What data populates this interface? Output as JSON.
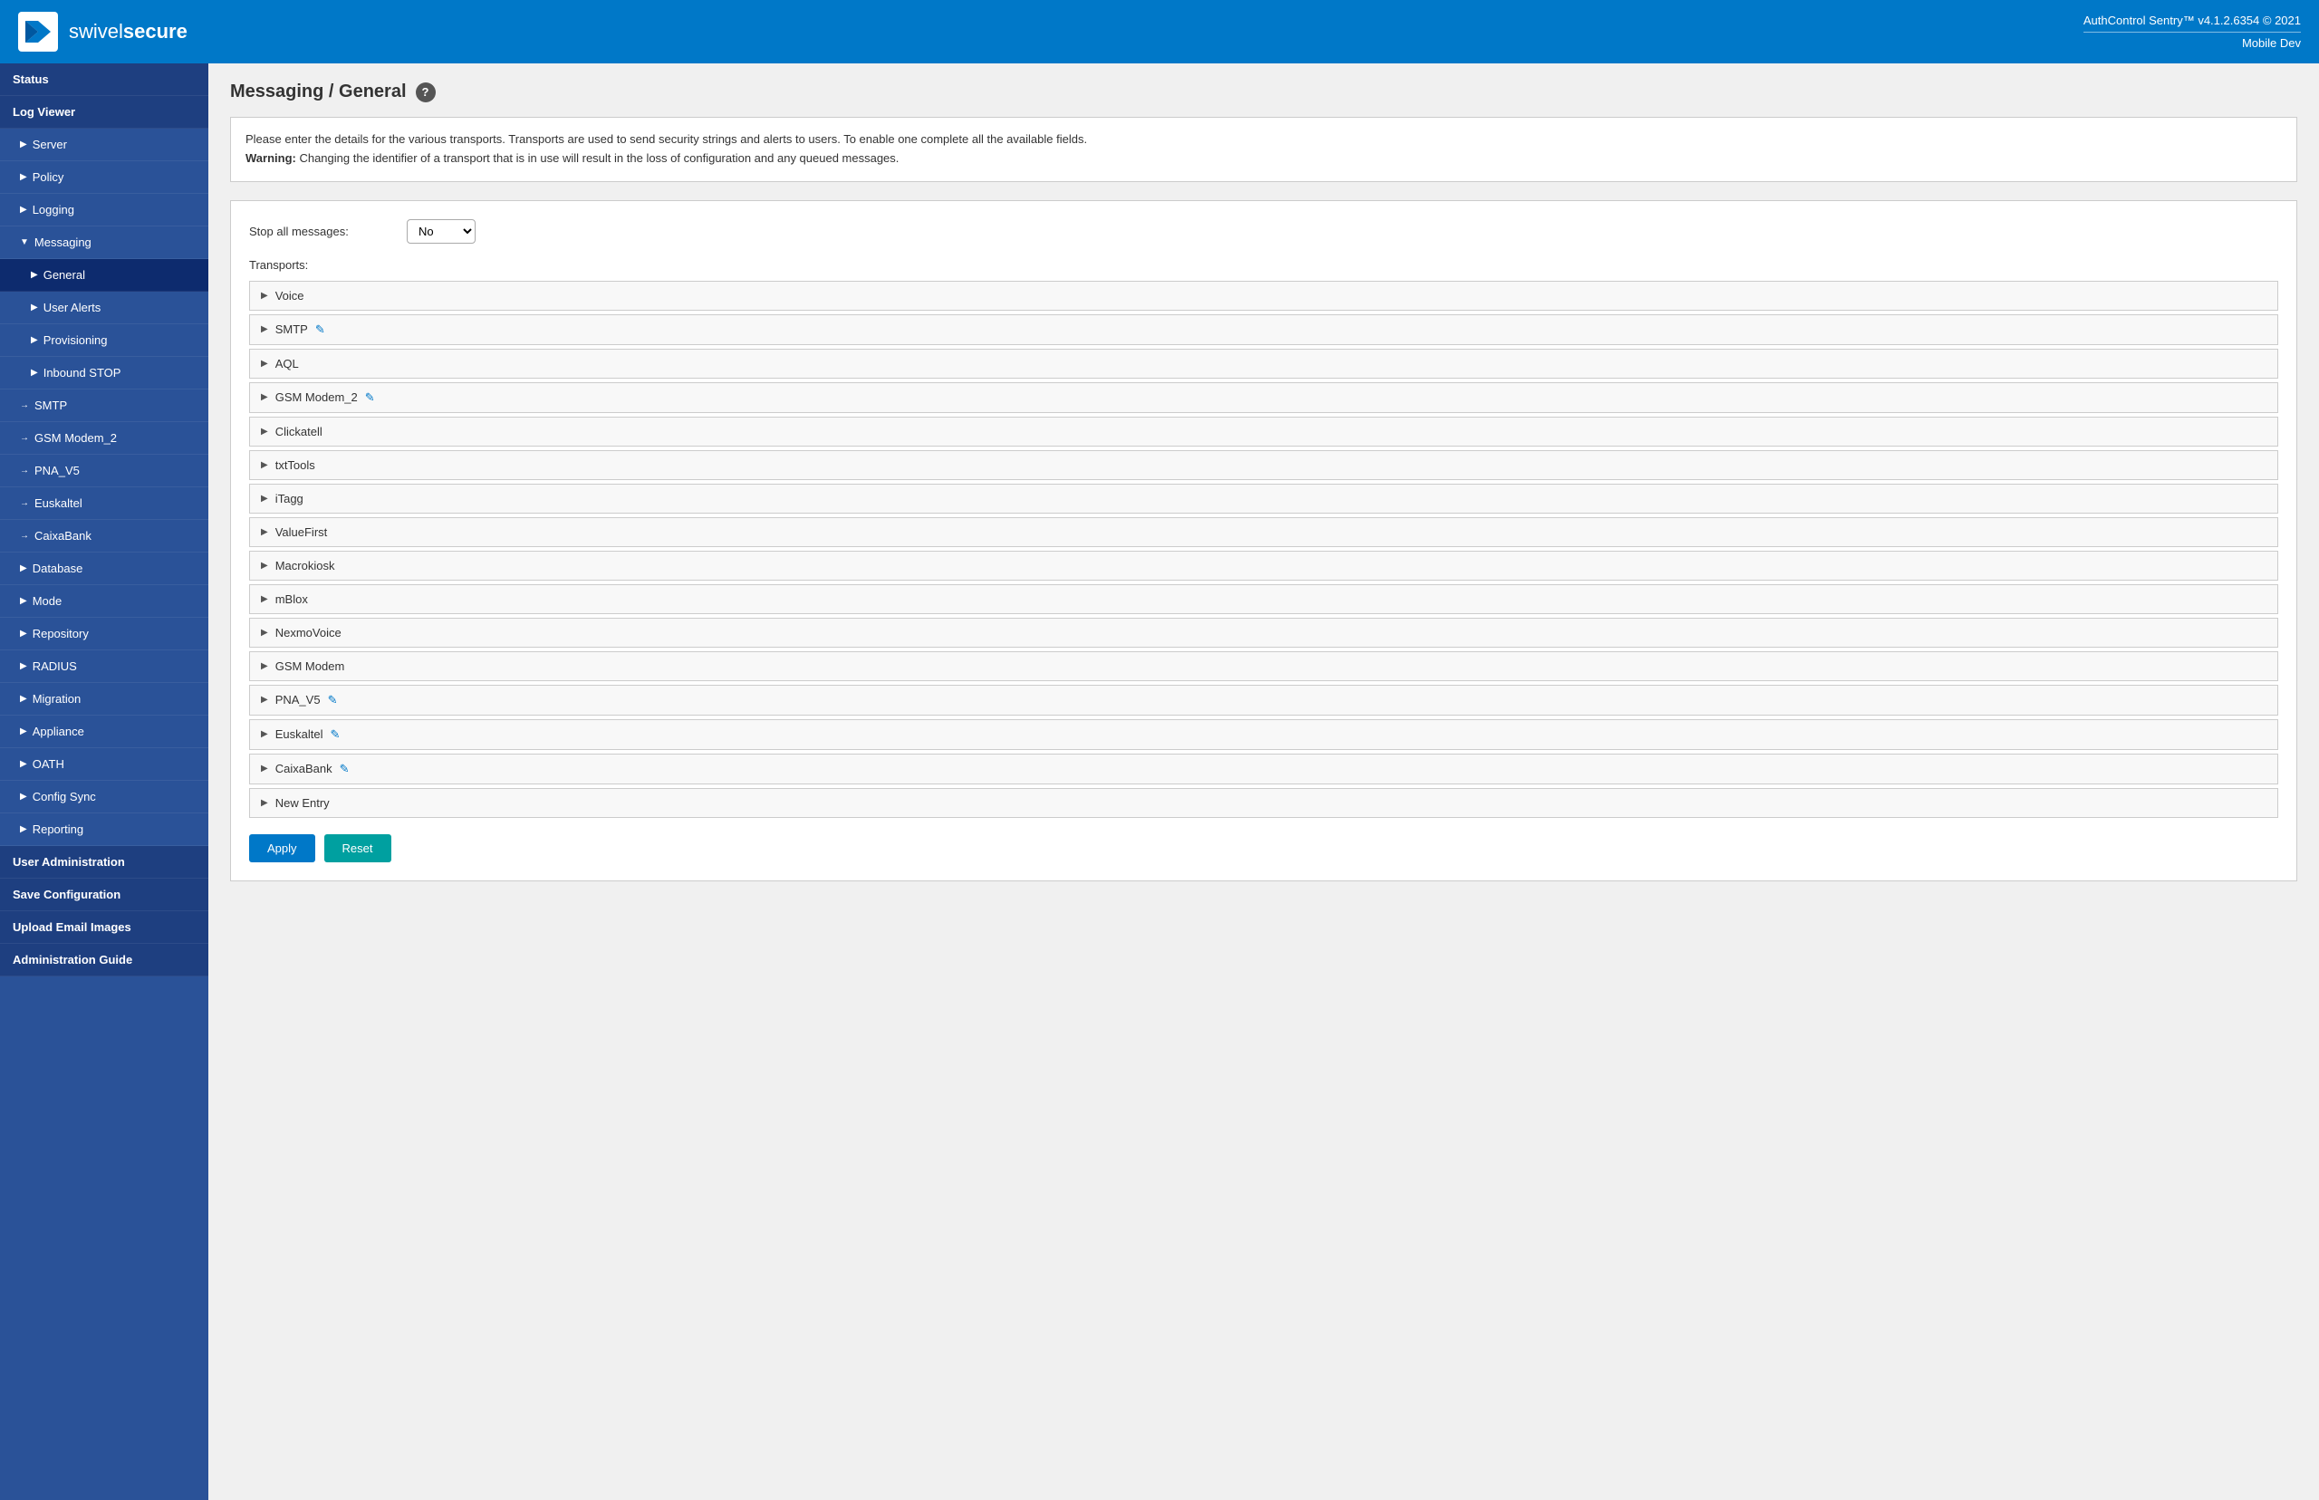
{
  "header": {
    "logo_brand": "swivel",
    "logo_brand2": "secure",
    "app_version": "AuthControl Sentry™ v4.1.2.6354 © 2021",
    "app_env": "Mobile Dev"
  },
  "sidebar": {
    "items": [
      {
        "id": "status",
        "label": "Status",
        "level": "top",
        "active": false
      },
      {
        "id": "log-viewer",
        "label": "Log Viewer",
        "level": "top",
        "active": false
      },
      {
        "id": "server",
        "label": "Server",
        "level": "sub",
        "arrow": "▶",
        "active": false
      },
      {
        "id": "policy",
        "label": "Policy",
        "level": "sub",
        "arrow": "▶",
        "active": false
      },
      {
        "id": "logging",
        "label": "Logging",
        "level": "sub",
        "arrow": "▶",
        "active": false
      },
      {
        "id": "messaging",
        "label": "Messaging",
        "level": "sub",
        "arrow": "▼",
        "active": false,
        "expanded": true
      },
      {
        "id": "general",
        "label": "General",
        "level": "sub-sub",
        "arrow": "▶",
        "active": true
      },
      {
        "id": "user-alerts",
        "label": "User Alerts",
        "level": "sub-sub",
        "arrow": "▶",
        "active": false
      },
      {
        "id": "provisioning",
        "label": "Provisioning",
        "level": "sub-sub",
        "arrow": "▶",
        "active": false
      },
      {
        "id": "inbound-stop",
        "label": "Inbound STOP",
        "level": "sub-sub",
        "arrow": "▶",
        "active": false
      },
      {
        "id": "smtp",
        "label": "SMTP",
        "level": "sub",
        "arrow": "→",
        "active": false
      },
      {
        "id": "gsm-modem2",
        "label": "GSM Modem_2",
        "level": "sub",
        "arrow": "→",
        "active": false
      },
      {
        "id": "pna-v5",
        "label": "PNA_V5",
        "level": "sub",
        "arrow": "→",
        "active": false
      },
      {
        "id": "euskaltel",
        "label": "Euskaltel",
        "level": "sub",
        "arrow": "→",
        "active": false
      },
      {
        "id": "caixabank",
        "label": "CaixaBank",
        "level": "sub",
        "arrow": "→",
        "active": false
      },
      {
        "id": "database",
        "label": "Database",
        "level": "sub",
        "arrow": "▶",
        "active": false
      },
      {
        "id": "mode",
        "label": "Mode",
        "level": "sub",
        "arrow": "▶",
        "active": false
      },
      {
        "id": "repository",
        "label": "Repository",
        "level": "sub",
        "arrow": "▶",
        "active": false
      },
      {
        "id": "radius",
        "label": "RADIUS",
        "level": "sub",
        "arrow": "▶",
        "active": false
      },
      {
        "id": "migration",
        "label": "Migration",
        "level": "sub",
        "arrow": "▶",
        "active": false
      },
      {
        "id": "appliance",
        "label": "Appliance",
        "level": "sub",
        "arrow": "▶",
        "active": false
      },
      {
        "id": "oath",
        "label": "OATH",
        "level": "sub",
        "arrow": "▶",
        "active": false
      },
      {
        "id": "config-sync",
        "label": "Config Sync",
        "level": "sub",
        "arrow": "▶",
        "active": false
      },
      {
        "id": "reporting",
        "label": "Reporting",
        "level": "sub",
        "arrow": "▶",
        "active": false
      },
      {
        "id": "user-admin",
        "label": "User Administration",
        "level": "top",
        "active": false
      },
      {
        "id": "save-config",
        "label": "Save Configuration",
        "level": "top",
        "active": false
      },
      {
        "id": "upload-email",
        "label": "Upload Email Images",
        "level": "top",
        "active": false
      },
      {
        "id": "admin-guide",
        "label": "Administration Guide",
        "level": "top",
        "active": false
      }
    ]
  },
  "page": {
    "title": "Messaging / General",
    "info_text": "Please enter the details for the various transports. Transports are used to send security strings and alerts to users. To enable one complete all the available fields.",
    "warning_text": "Warning:",
    "warning_detail": " Changing the identifier of a transport that is in use will result in the loss of configuration and any queued messages.",
    "stop_all_label": "Stop all messages:",
    "stop_all_value": "No",
    "transports_label": "Transports:",
    "transports": [
      {
        "name": "Voice",
        "configured": false
      },
      {
        "name": "SMTP",
        "configured": true
      },
      {
        "name": "AQL",
        "configured": false
      },
      {
        "name": "GSM Modem_2",
        "configured": true
      },
      {
        "name": "Clickatell",
        "configured": false
      },
      {
        "name": "txtTools",
        "configured": false
      },
      {
        "name": "iTagg",
        "configured": false
      },
      {
        "name": "ValueFirst",
        "configured": false
      },
      {
        "name": "Macrokiosk",
        "configured": false
      },
      {
        "name": "mBlox",
        "configured": false
      },
      {
        "name": "NexmoVoice",
        "configured": false
      },
      {
        "name": "GSM Modem",
        "configured": false
      },
      {
        "name": "PNA_V5",
        "configured": true
      },
      {
        "name": "Euskaltel",
        "configured": true
      },
      {
        "name": "CaixaBank",
        "configured": true
      },
      {
        "name": "New Entry",
        "configured": false
      }
    ],
    "btn_apply": "Apply",
    "btn_reset": "Reset"
  }
}
